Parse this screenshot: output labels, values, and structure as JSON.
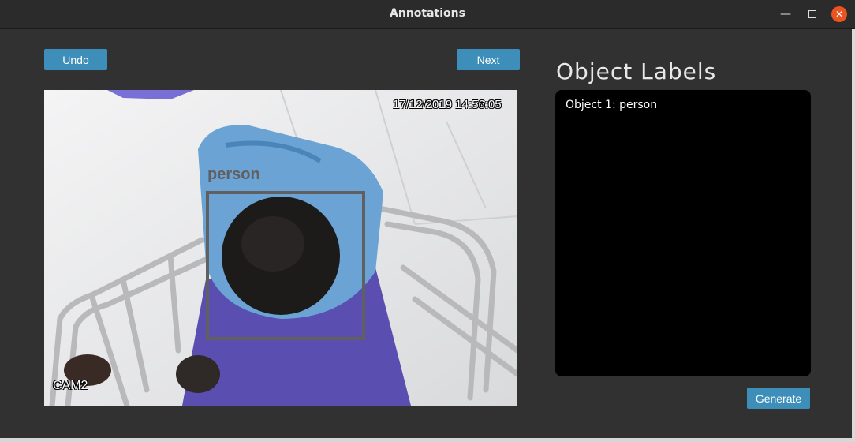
{
  "window": {
    "title": "Annotations"
  },
  "toolbar": {
    "undo_label": "Undo",
    "next_label": "Next"
  },
  "panel": {
    "heading": "Object Labels",
    "objects": [
      {
        "label": "Object 1: person"
      }
    ],
    "generate_label": "Generate"
  },
  "image": {
    "timestamp": "17/12/2019 14:56:05",
    "camera": "CAM2",
    "annotations": [
      {
        "label": "person"
      }
    ]
  },
  "colors": {
    "accent": "#3d8eb9",
    "close": "#e95420",
    "box": "#606060"
  }
}
